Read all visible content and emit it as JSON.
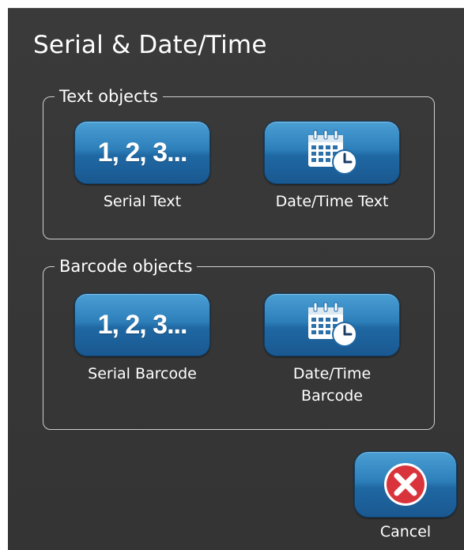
{
  "dialog": {
    "title": "Serial & Date/Time"
  },
  "text_objects": {
    "legend": "Text objects",
    "serial": {
      "icon_text": "1, 2, 3...",
      "label": "Serial Text"
    },
    "datetime": {
      "icon": "calendar-clock-icon",
      "label": "Date/Time Text"
    }
  },
  "barcode_objects": {
    "legend": "Barcode objects",
    "serial": {
      "icon_text": "1, 2, 3...",
      "label": "Serial Barcode"
    },
    "datetime": {
      "icon": "calendar-clock-icon",
      "label_line1": "Date/Time",
      "label_line2": "Barcode"
    }
  },
  "cancel": {
    "icon": "red-x-icon",
    "label": "Cancel"
  },
  "colors": {
    "dialog_bg": "#383838",
    "button_blue": "#2d7fba",
    "cancel_red": "#d9343c"
  }
}
